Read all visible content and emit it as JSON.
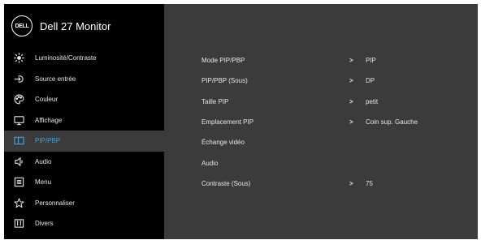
{
  "header": {
    "logo_text": "DELL",
    "title": "Dell 27 Monitor"
  },
  "sidebar": {
    "items": [
      {
        "label": "Luminosité/Contraste",
        "icon": "brightness-icon"
      },
      {
        "label": "Source entrée",
        "icon": "input-source-icon"
      },
      {
        "label": "Couleur",
        "icon": "color-palette-icon"
      },
      {
        "label": "Affichage",
        "icon": "display-icon"
      },
      {
        "label": "PIP/PBP",
        "icon": "pip-icon",
        "active": true
      },
      {
        "label": "Audio",
        "icon": "speaker-icon"
      },
      {
        "label": "Menu",
        "icon": "menu-icon"
      },
      {
        "label": "Personnaliser",
        "icon": "star-icon"
      },
      {
        "label": "Divers",
        "icon": "info-icon"
      }
    ]
  },
  "settings": [
    {
      "label": "Mode PIP/PBP",
      "chevron": ">",
      "value": "PIP"
    },
    {
      "label": "PIP/PBP (Sous)",
      "chevron": ">",
      "value": "DP"
    },
    {
      "label": "Taille PIP",
      "chevron": ">",
      "value": "petit"
    },
    {
      "label": "Emplacement PIP",
      "chevron": ">",
      "value": "Coin sup. Gauche"
    },
    {
      "label": "Échange vidéo"
    },
    {
      "label": "Audio"
    },
    {
      "label": "Contraste (Sous)",
      "chevron": ">",
      "value": "75"
    }
  ],
  "colors": {
    "accent": "#37a8e6",
    "panel": "#3b3b3b",
    "background": "#000000",
    "text": "#e6e6e6"
  }
}
